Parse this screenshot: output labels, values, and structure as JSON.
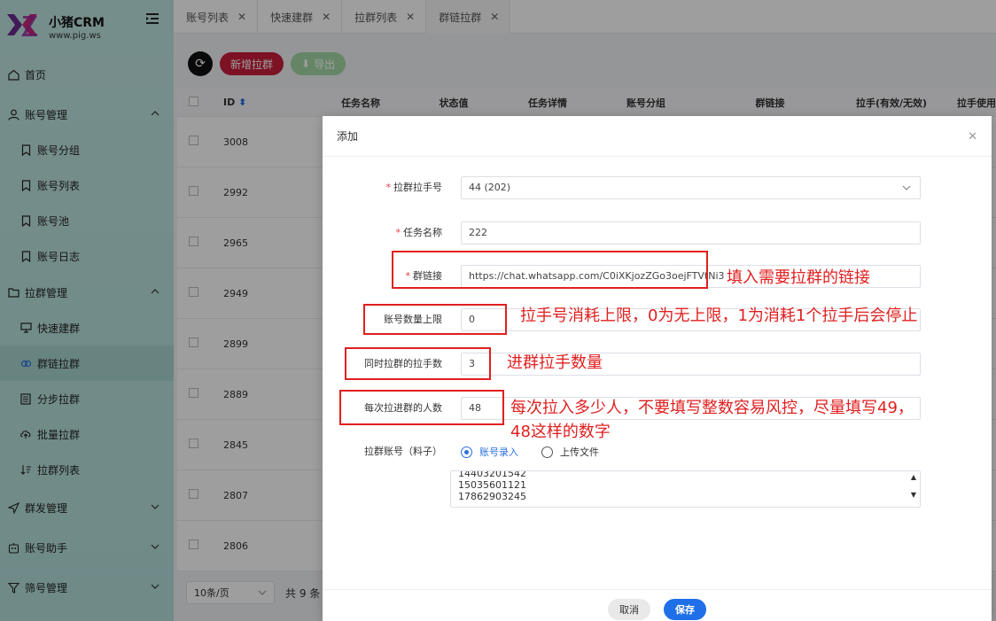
{
  "brand": {
    "name": "小猪CRM",
    "url": "www.pig.ws",
    "logo_text": "XZ"
  },
  "sidebar": {
    "items": [
      {
        "label": "首页",
        "icon": "home-icon",
        "level": 1
      },
      {
        "label": "账号管理",
        "icon": "user-icon",
        "level": 1,
        "chevron": "up"
      },
      {
        "label": "账号分组",
        "icon": "bookmark-icon",
        "level": 2
      },
      {
        "label": "账号列表",
        "icon": "bookmark-icon",
        "level": 2
      },
      {
        "label": "账号池",
        "icon": "bookmark-icon",
        "level": 2
      },
      {
        "label": "账号日志",
        "icon": "bookmark-icon",
        "level": 2
      },
      {
        "label": "拉群管理",
        "icon": "folder-icon",
        "level": 1,
        "chevron": "up"
      },
      {
        "label": "快速建群",
        "icon": "monitor-icon",
        "level": 2
      },
      {
        "label": "群链拉群",
        "icon": "link-icon",
        "level": 2,
        "active": true
      },
      {
        "label": "分步拉群",
        "icon": "list-icon",
        "level": 2
      },
      {
        "label": "批量拉群",
        "icon": "cloud-upload-icon",
        "level": 2
      },
      {
        "label": "拉群列表",
        "icon": "sort-icon",
        "level": 2
      },
      {
        "label": "群发管理",
        "icon": "send-icon",
        "level": 1,
        "chevron": "down"
      },
      {
        "label": "账号助手",
        "icon": "robot-icon",
        "level": 1,
        "chevron": "down"
      },
      {
        "label": "筛号管理",
        "icon": "filter-icon",
        "level": 1,
        "chevron": "down"
      }
    ]
  },
  "tabs": [
    {
      "label": "账号列表",
      "active": false
    },
    {
      "label": "快速建群",
      "active": false
    },
    {
      "label": "拉群列表",
      "active": false
    },
    {
      "label": "群链拉群",
      "active": true
    }
  ],
  "toolbar": {
    "new_label": "新增拉群",
    "export_label": "导出"
  },
  "table": {
    "headers": [
      "ID",
      "任务名称",
      "状态值",
      "任务详情",
      "账号分组",
      "群链接",
      "拉手(有效/无效)",
      "拉手使用"
    ],
    "ids": [
      "3008",
      "2992",
      "2965",
      "2949",
      "2899",
      "2889",
      "2845",
      "2807",
      "2806"
    ]
  },
  "pager": {
    "page_size": "10条/页",
    "total": "共 9 条"
  },
  "modal": {
    "title": "添加",
    "fields": {
      "puller": {
        "label": "拉群拉手号",
        "value": "44 (202)",
        "required": true
      },
      "task_name": {
        "label": "任务名称",
        "value": "222",
        "required": true
      },
      "group_link": {
        "label": "群链接",
        "value": "https://chat.whatsapp.com/C0iXKjozZGo3oejFTVtNi3",
        "required": true
      },
      "account_limit": {
        "label": "账号数量上限",
        "value": "0"
      },
      "simultaneous": {
        "label": "同时拉群的拉手数",
        "value": "3"
      },
      "per_pull": {
        "label": "每次拉进群的人数",
        "value": "48"
      },
      "source": {
        "label": "拉群账号（料子）",
        "options": [
          "账号录入",
          "上传文件"
        ],
        "selected": "账号录入"
      }
    },
    "textarea_lines": [
      "14403201542",
      "15035601121",
      "17862903245"
    ],
    "cancel_label": "取消",
    "save_label": "保存"
  },
  "annotations": {
    "group_link": "填入需要拉群的链接",
    "account_limit": "拉手号消耗上限，0为无上限，1为消耗1个拉手后会停止",
    "simultaneous": "进群拉手数量",
    "per_pull_line1": "每次拉入多少人，不要填写整数容易风控，尽量填写49，",
    "per_pull_line2": "48这样的数字"
  },
  "colors": {
    "sidebar_bg": "#bfe5e1",
    "primary": "#1e6fe8",
    "danger": "#c81e3a",
    "annotation": "#e02020"
  }
}
